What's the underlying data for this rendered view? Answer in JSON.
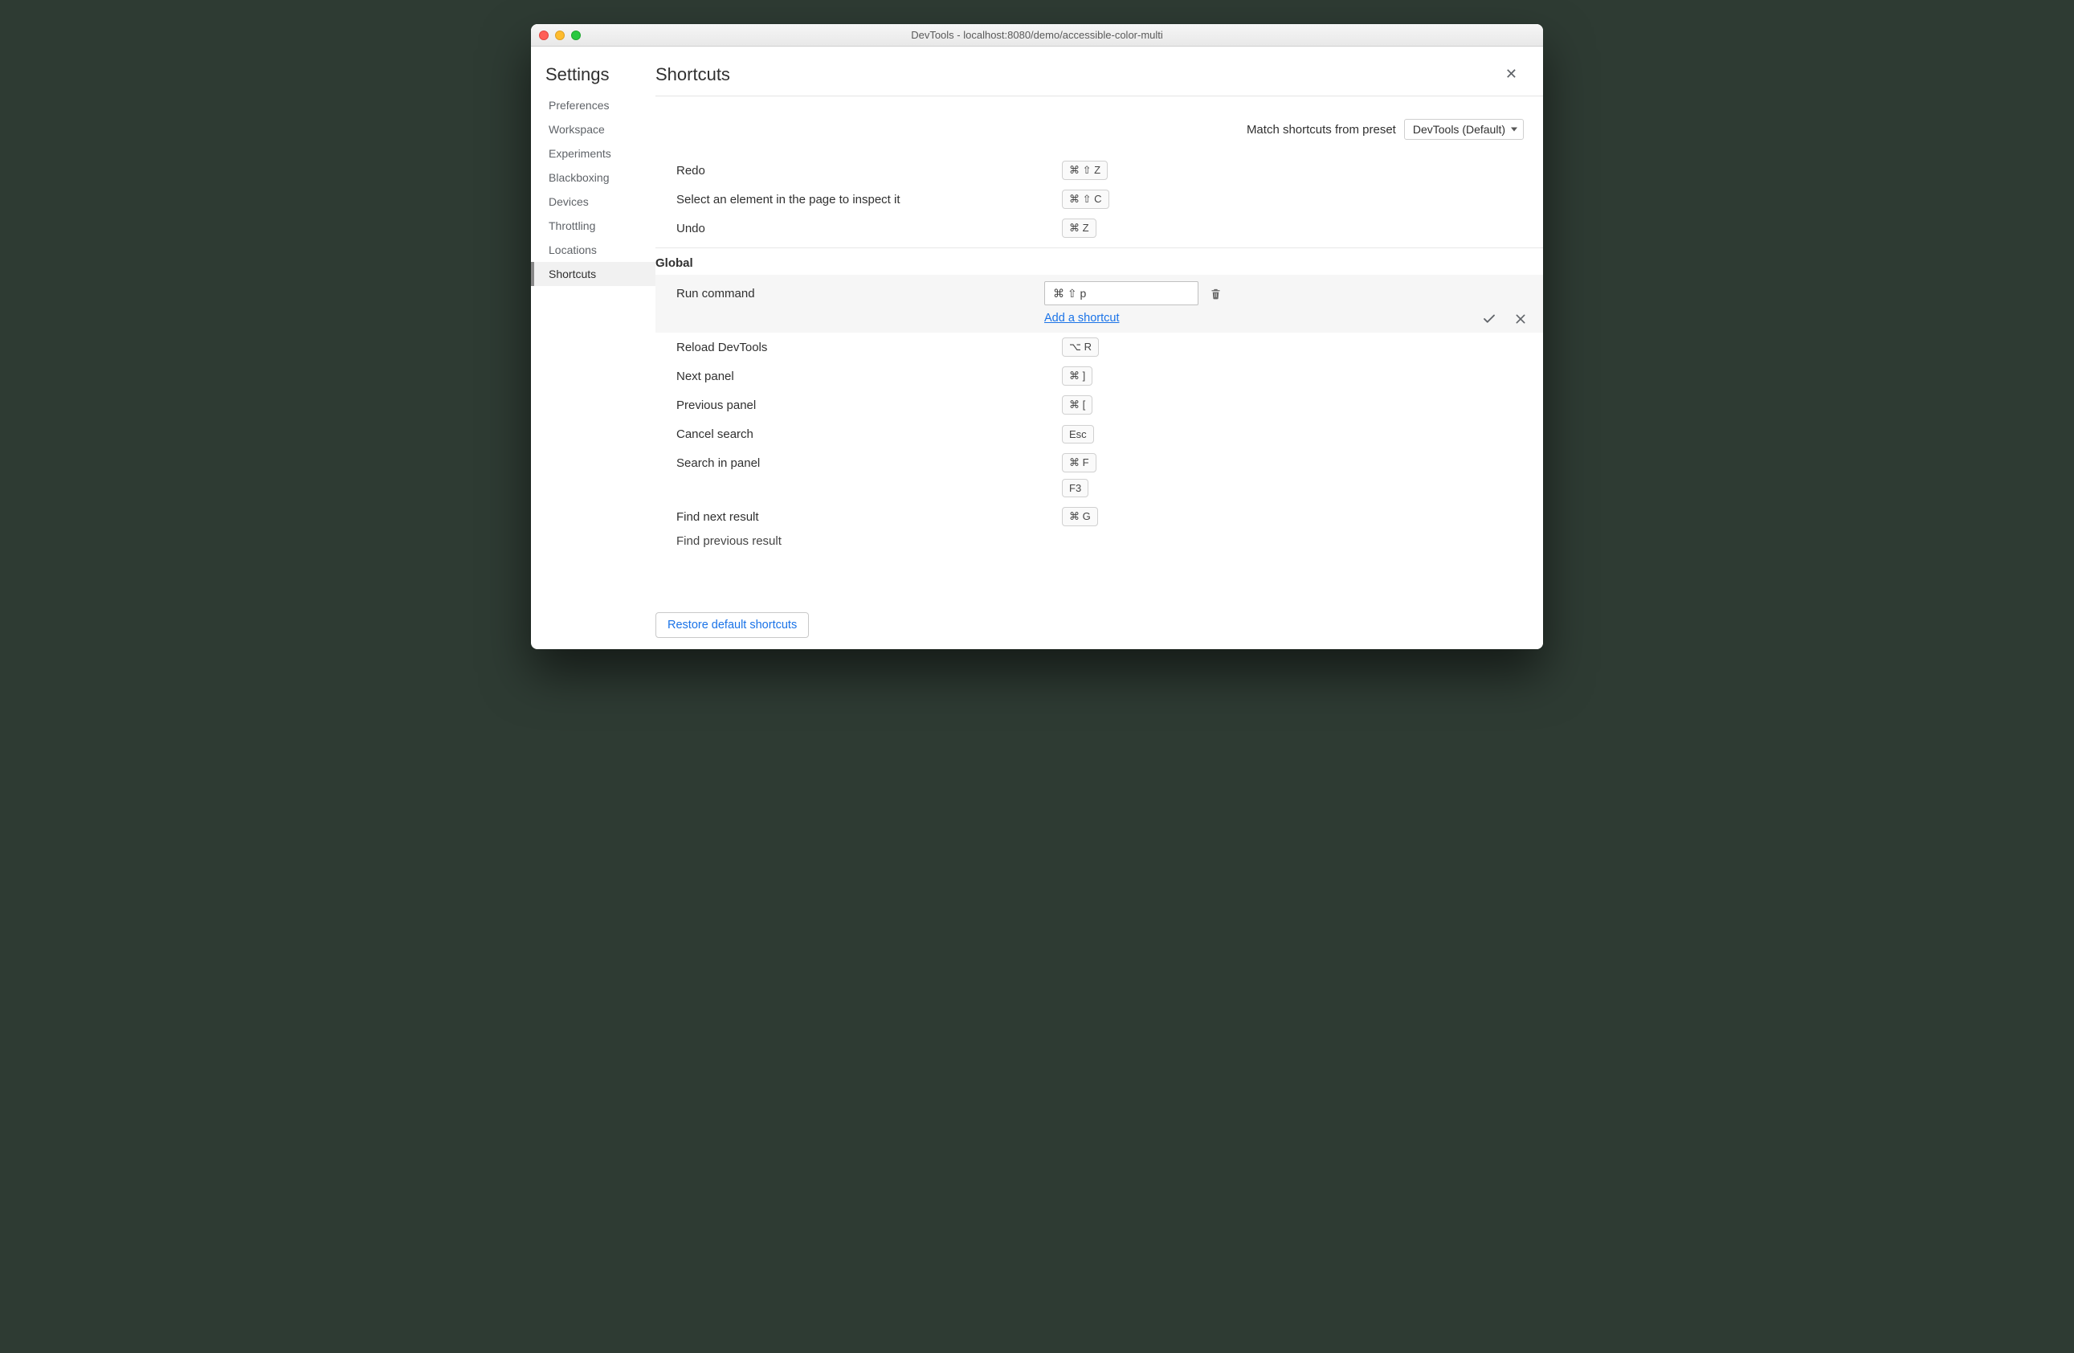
{
  "window": {
    "title": "DevTools - localhost:8080/demo/accessible-color-multi"
  },
  "sidebar": {
    "title": "Settings",
    "items": [
      {
        "label": "Preferences"
      },
      {
        "label": "Workspace"
      },
      {
        "label": "Experiments"
      },
      {
        "label": "Blackboxing"
      },
      {
        "label": "Devices"
      },
      {
        "label": "Throttling"
      },
      {
        "label": "Locations"
      },
      {
        "label": "Shortcuts"
      }
    ],
    "activeIndex": 7
  },
  "header": {
    "title": "Shortcuts",
    "close": "✕"
  },
  "preset": {
    "label": "Match shortcuts from preset",
    "value": "DevTools (Default)"
  },
  "topRows": [
    {
      "label": "Redo",
      "key": "⌘ ⇧ Z"
    },
    {
      "label": "Select an element in the page to inspect it",
      "key": "⌘ ⇧ C"
    },
    {
      "label": "Undo",
      "key": "⌘ Z"
    }
  ],
  "section": {
    "title": "Global"
  },
  "editing": {
    "label": "Run command",
    "inputValue": "⌘ ⇧ p",
    "addLink": "Add a shortcut"
  },
  "globalRows": [
    {
      "label": "Reload DevTools",
      "keys": [
        "⌥ R"
      ]
    },
    {
      "label": "Next panel",
      "keys": [
        "⌘ ]"
      ]
    },
    {
      "label": "Previous panel",
      "keys": [
        "⌘ ["
      ]
    },
    {
      "label": "Cancel search",
      "keys": [
        "Esc"
      ]
    },
    {
      "label": "Search in panel",
      "keys": [
        "⌘ F",
        "F3"
      ]
    },
    {
      "label": "Find next result",
      "keys": [
        "⌘ G"
      ]
    }
  ],
  "cutRow": {
    "label": "Find previous result"
  },
  "footer": {
    "restore": "Restore default shortcuts"
  }
}
